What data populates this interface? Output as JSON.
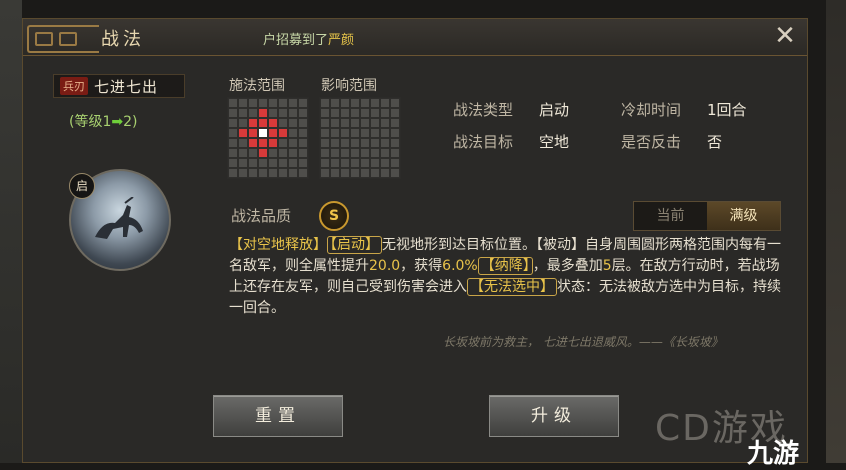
{
  "dialog": {
    "title": "战法",
    "notice_prefix": "户招募到了",
    "notice_name": "严颜",
    "close_symbol": "✕"
  },
  "skill": {
    "type_tag": "兵刃",
    "name": "七进七出",
    "level_text": "(等级1",
    "level_arrow": "➡",
    "level_target": "2)",
    "start_badge": "启"
  },
  "ranges": {
    "cast_label": "施法范围",
    "effect_label": "影响范围"
  },
  "info": {
    "type_label": "战法类型",
    "type_value": "启动",
    "cooldown_label": "冷却时间",
    "cooldown_value": "1回合",
    "target_label": "战法目标",
    "target_value": "空地",
    "counter_label": "是否反击",
    "counter_value": "否"
  },
  "quality": {
    "label": "战法品质",
    "grade": "S"
  },
  "toggle": {
    "current": "当前",
    "max": "满级"
  },
  "description": {
    "p1": "【对空地释放】",
    "p2": "【启动】",
    "p3": "无视地形到达目标位置。【被动】自身周围圆形两格范围内每有一名敌军，则全属性提升",
    "p4": "20.0",
    "p5": "，获得",
    "p6": "6.0%",
    "p7": "【纳降】",
    "p8": "，最多叠加",
    "p9": "5",
    "p10": "层。在敌方行动时，若战场上还存在友军，则自己受到伤害会进入",
    "p11": "【无法选中】",
    "p12": "状态：无法被敌方选中为目标，持续一回合。"
  },
  "quote": "长坂坡前为救主， 七进七出退威风。——《长坂坡》",
  "buttons": {
    "reset": "重置",
    "upgrade": "升级"
  },
  "watermark": {
    "text": "CD游戏",
    "logo": "九游"
  },
  "colors": {
    "accent_gold": "#e8c34a",
    "cast_red": "#d83a3a",
    "level_green": "#a8d070"
  }
}
